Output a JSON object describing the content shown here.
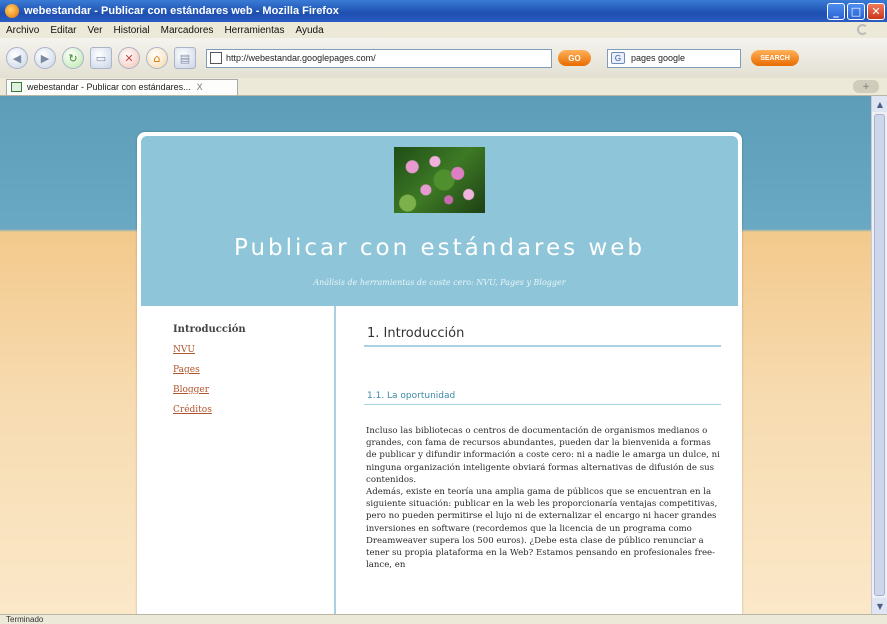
{
  "window": {
    "title": "webestandar - Publicar con estándares web - Mozilla Firefox",
    "controls": {
      "minimize": "_",
      "maximize": "□",
      "close": "✕"
    }
  },
  "menu": [
    "Archivo",
    "Editar",
    "Ver",
    "Historial",
    "Marcadores",
    "Herramientas",
    "Ayuda"
  ],
  "toolbar": {
    "url": "http://webestandar.googlepages.com/",
    "go_label": "GO",
    "search_value": "pages google",
    "search_label": "SEARCH"
  },
  "tab": {
    "label": "webestandar - Publicar con estándares...",
    "close": "X"
  },
  "page": {
    "title": "Publicar con estándares web",
    "subtitle": "Análisis de herramientas de coste cero: NVU, Pages y Blogger",
    "sidebar": {
      "heading": "Introducción",
      "links": [
        "NVU",
        "Pages",
        "Blogger",
        "Créditos"
      ]
    },
    "main": {
      "h1": "1. Introducción",
      "h2": "1.1. La oportunidad",
      "paragraph": "Incluso las bibliotecas o centros de documentación de organismos medianos o grandes, con fama de recursos abundantes, pueden dar la bienvenida a formas de publicar y difundir información a coste cero: ni a nadie le amarga un dulce, ni ninguna organización inteligente obviará formas alternativas de difusión de sus contenidos.",
      "paragraph2": "Además, existe en teoría una amplia gama de públicos que se encuentran en la siguiente situación: publicar en la web les proporcionaría ventajas competitivas, pero no pueden permitirse el lujo ni de externalizar el encargo ni hacer grandes inversiones en software (recordemos que la licencia de un programa como Dreamweaver supera los 500 euros). ¿Debe esta clase de público renunciar a tener su propia plataforma en la Web? Estamos pensando en profesionales free-lance, en"
    }
  },
  "status": "Terminado",
  "colors": {
    "header": "#8ec5d8",
    "link": "#b0542d",
    "accent": "#3b8aa8"
  }
}
